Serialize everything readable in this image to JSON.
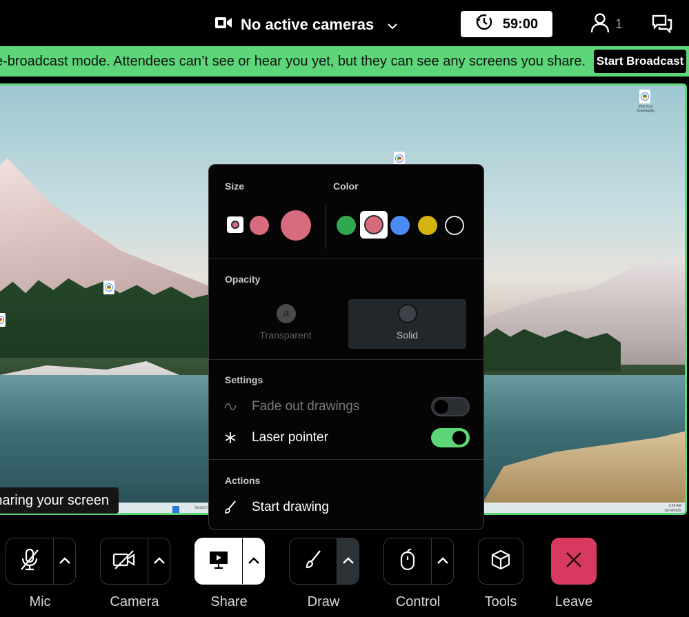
{
  "topbar": {
    "camera_status": "No active cameras",
    "timer": "59:00",
    "participant_count": "1"
  },
  "banner": {
    "message": "n pre-broadcast mode. Attendees can’t see or hear you yet, but they can see any screens you share.",
    "button_label": "Start Broadcast",
    "color": "#5cd678"
  },
  "stage": {
    "sharing_label": "haring your screen",
    "desktop_icon_label": "Pick Your Community",
    "taskbar_search": "Search",
    "taskbar_time": "9:24 AM",
    "taskbar_date": "10/14/2025"
  },
  "draw_menu": {
    "size_title": "Size",
    "color_title": "Color",
    "colors": [
      "#2fa84f",
      "#d86b7d",
      "#4a8bf5",
      "#d4b50e",
      "#000000"
    ],
    "selected_color": "#d86b7d",
    "opacity_title": "Opacity",
    "opacity_options": [
      {
        "label": "Transparent",
        "glyph": "a"
      },
      {
        "label": "Solid"
      }
    ],
    "settings_title": "Settings",
    "settings": [
      {
        "label": "Fade out drawings",
        "enabled": false,
        "icon": "squiggle-icon"
      },
      {
        "label": "Laser pointer",
        "enabled": true,
        "icon": "asterisk-icon"
      }
    ],
    "actions_title": "Actions",
    "actions": [
      {
        "label": "Start drawing",
        "icon": "brush-icon"
      }
    ]
  },
  "toolbar": {
    "mic": "Mic",
    "camera": "Camera",
    "share": "Share",
    "draw": "Draw",
    "control": "Control",
    "tools": "Tools",
    "leave": "Leave",
    "leave_color": "#d83a5f"
  }
}
